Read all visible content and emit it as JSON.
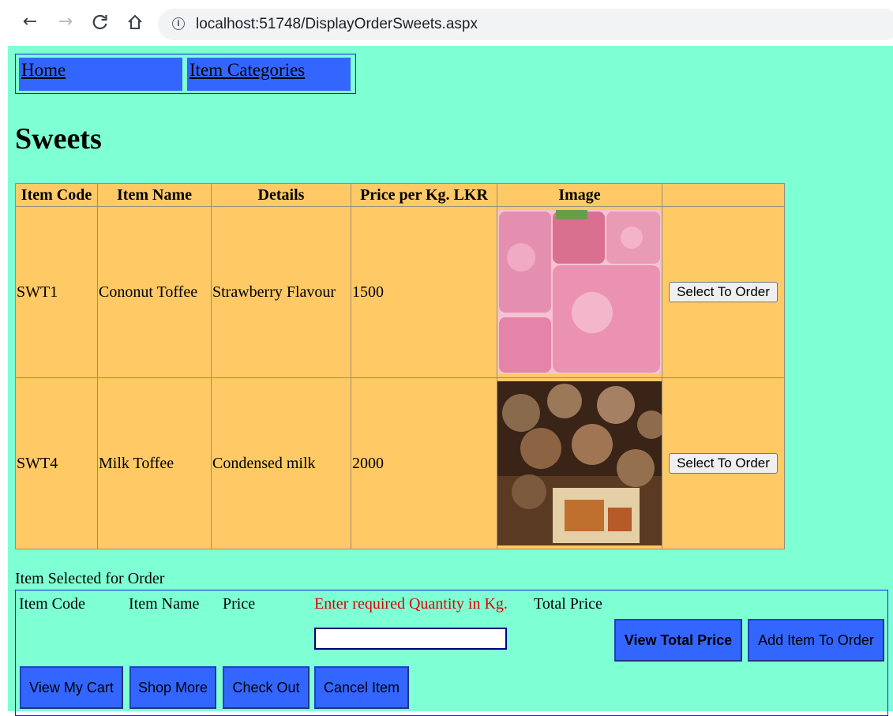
{
  "browser": {
    "url": "localhost:51748/DisplayOrderSweets.aspx",
    "back_glyph": "←",
    "forward_glyph": "→",
    "reload_glyph": "C",
    "home_glyph": "⌂",
    "info_glyph": "i"
  },
  "menu": {
    "home": "Home",
    "categories": "Item Categories"
  },
  "page_title": "Sweets",
  "table": {
    "headers": [
      "Item Code",
      "Item Name",
      "Details",
      "Price per Kg. LKR",
      "Image",
      ""
    ],
    "rows": [
      {
        "code": "SWT1",
        "name": "Cononut Toffee",
        "details": "Strawberry Flavour",
        "price": "1500",
        "image": "pink-coconut-toffee-photo",
        "action": "Select To Order"
      },
      {
        "code": "SWT4",
        "name": "Milk Toffee",
        "details": "Condensed milk",
        "price": "2000",
        "image": "milk-toffee-cups-photo",
        "action": "Select To Order"
      }
    ]
  },
  "selection": {
    "caption": "Item Selected for Order",
    "item_code_label": "Item Code",
    "item_name_label": "Item Name",
    "price_label": "Price",
    "qty_prompt": "Enter required Quantity in Kg.",
    "total_label": "Total Price",
    "qty_value": "",
    "buttons": {
      "view_total": "View Total Price",
      "add_item": "Add Item To Order",
      "view_cart": "View My Cart",
      "shop_more": "Shop More",
      "check_out": "Check Out",
      "cancel_item": "Cancel Item"
    }
  },
  "colors": {
    "page_bg": "#7fffd4",
    "table_bg": "#ffc966",
    "button_blue": "#3366ff",
    "prompt_red": "#e00000"
  }
}
